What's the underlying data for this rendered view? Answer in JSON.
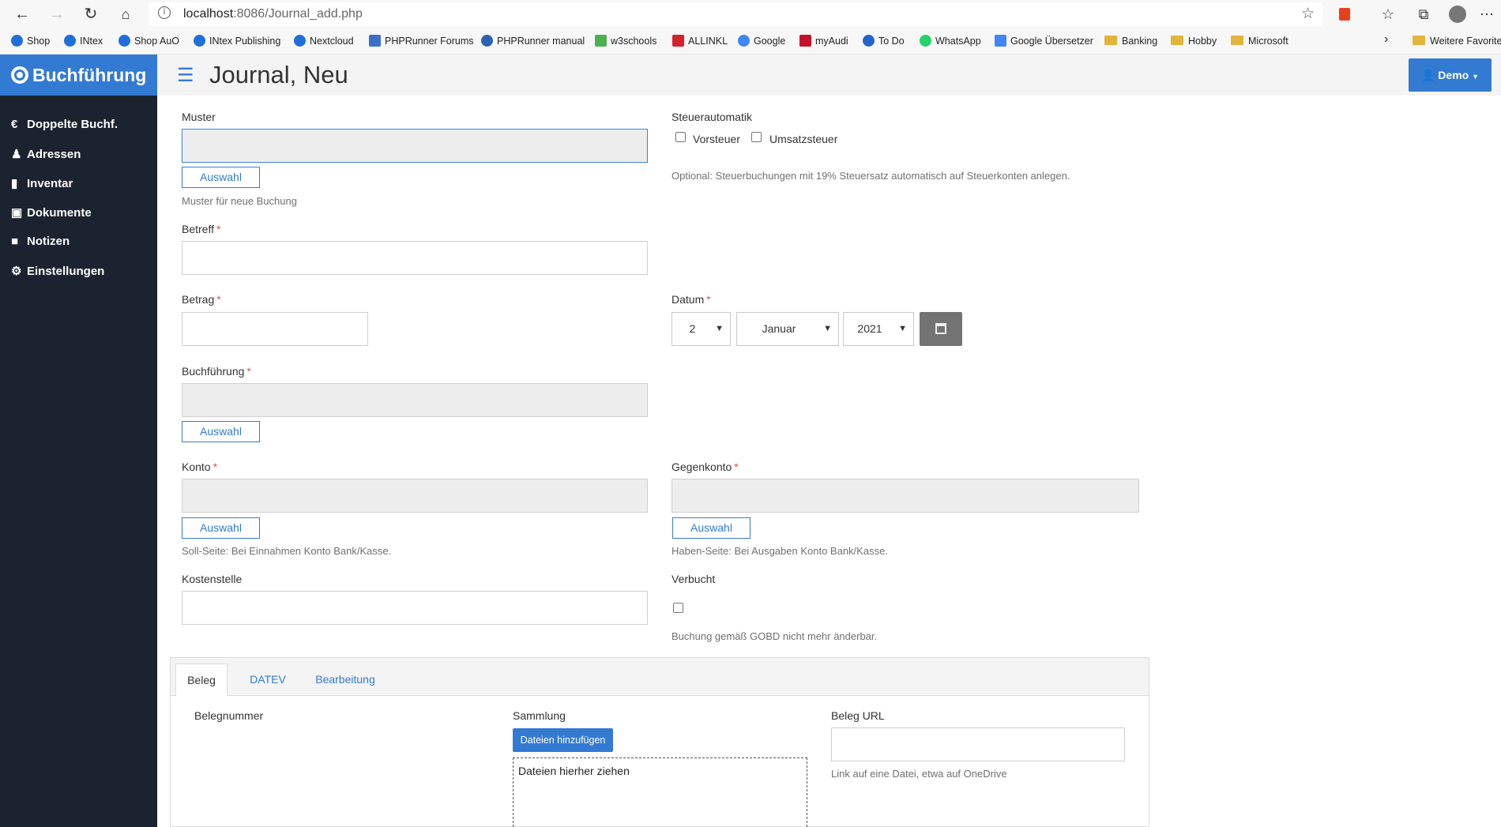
{
  "browser": {
    "url_prefix": "localhost",
    "url_rest": ":8086/Journal_add.php",
    "bookmarks": [
      {
        "label": "Shop",
        "color": "#1e6fd9"
      },
      {
        "label": "INtex",
        "color": "#1e6fd9"
      },
      {
        "label": "Shop AuO",
        "color": "#1e6fd9"
      },
      {
        "label": "INtex Publishing",
        "color": "#1e6fd9"
      },
      {
        "label": "Nextcloud",
        "color": "#1e6fd9"
      },
      {
        "label": "PHPRunner Forums",
        "color": "#3d6fc9"
      },
      {
        "label": "PHPRunner manual",
        "color": "#2b62b3"
      },
      {
        "label": "w3schools",
        "color": "#4caf50"
      },
      {
        "label": "ALLINKL",
        "color": "#d6222a"
      },
      {
        "label": "Google",
        "color": "#4285f4"
      },
      {
        "label": "myAudi",
        "color": "#c8102e"
      },
      {
        "label": "To Do",
        "color": "#2564cf"
      },
      {
        "label": "WhatsApp",
        "color": "#25d366"
      },
      {
        "label": "Google Übersetzer",
        "color": "#4285f4"
      },
      {
        "label": "Banking",
        "color": "#e2b53a"
      },
      {
        "label": "Hobby",
        "color": "#e2b53a"
      },
      {
        "label": "Microsoft",
        "color": "#e2b53a"
      }
    ],
    "more_favorites": "Weitere Favorite"
  },
  "app": {
    "brand": "Buchführung",
    "page_title": "Journal, Neu",
    "user_button": "Demo",
    "sidebar": [
      {
        "label": "Doppelte Buchf.",
        "icon": "euro-icon"
      },
      {
        "label": "Adressen",
        "icon": "user-icon"
      },
      {
        "label": "Inventar",
        "icon": "barcode-icon"
      },
      {
        "label": "Dokumente",
        "icon": "document-icon"
      },
      {
        "label": "Notizen",
        "icon": "note-icon"
      },
      {
        "label": "Einstellungen",
        "icon": "gear-icon"
      }
    ]
  },
  "form": {
    "muster": {
      "label": "Muster",
      "value": "",
      "button": "Auswahl",
      "hint": "Muster für neue Buchung"
    },
    "steuerautomatik": {
      "label": "Steuerautomatik",
      "vorsteuer": "Vorsteuer",
      "umsatzsteuer": "Umsatzsteuer",
      "hint": "Optional: Steuerbuchungen mit 19% Steuersatz automatisch auf Steuerkonten anlegen."
    },
    "betreff": {
      "label": "Betreff",
      "value": ""
    },
    "betrag": {
      "label": "Betrag",
      "value": ""
    },
    "datum": {
      "label": "Datum",
      "day": "2",
      "month": "Januar",
      "year": "2021"
    },
    "buchfuehrung": {
      "label": "Buchführung",
      "value": "",
      "button": "Auswahl"
    },
    "konto": {
      "label": "Konto",
      "value": "",
      "button": "Auswahl",
      "hint": "Soll-Seite: Bei Einnahmen Konto Bank/Kasse."
    },
    "gegenkonto": {
      "label": "Gegenkonto",
      "value": "",
      "button": "Auswahl",
      "hint": "Haben-Seite: Bei Ausgaben Konto Bank/Kasse."
    },
    "kostenstelle": {
      "label": "Kostenstelle",
      "value": ""
    },
    "verbucht": {
      "label": "Verbucht",
      "hint": "Buchung gemäß GOBD nicht mehr änderbar."
    },
    "required_mark": "*"
  },
  "tabs": {
    "items": [
      "Beleg",
      "DATEV",
      "Bearbeitung"
    ],
    "belegnummer": "Belegnummer",
    "sammlung": "Sammlung",
    "add_files": "Dateien hinzufügen",
    "drop_zone": "Dateien hierher ziehen",
    "beleg_url": {
      "label": "Beleg URL",
      "value": "",
      "hint": "Link auf eine Datei, etwa auf OneDrive"
    }
  }
}
